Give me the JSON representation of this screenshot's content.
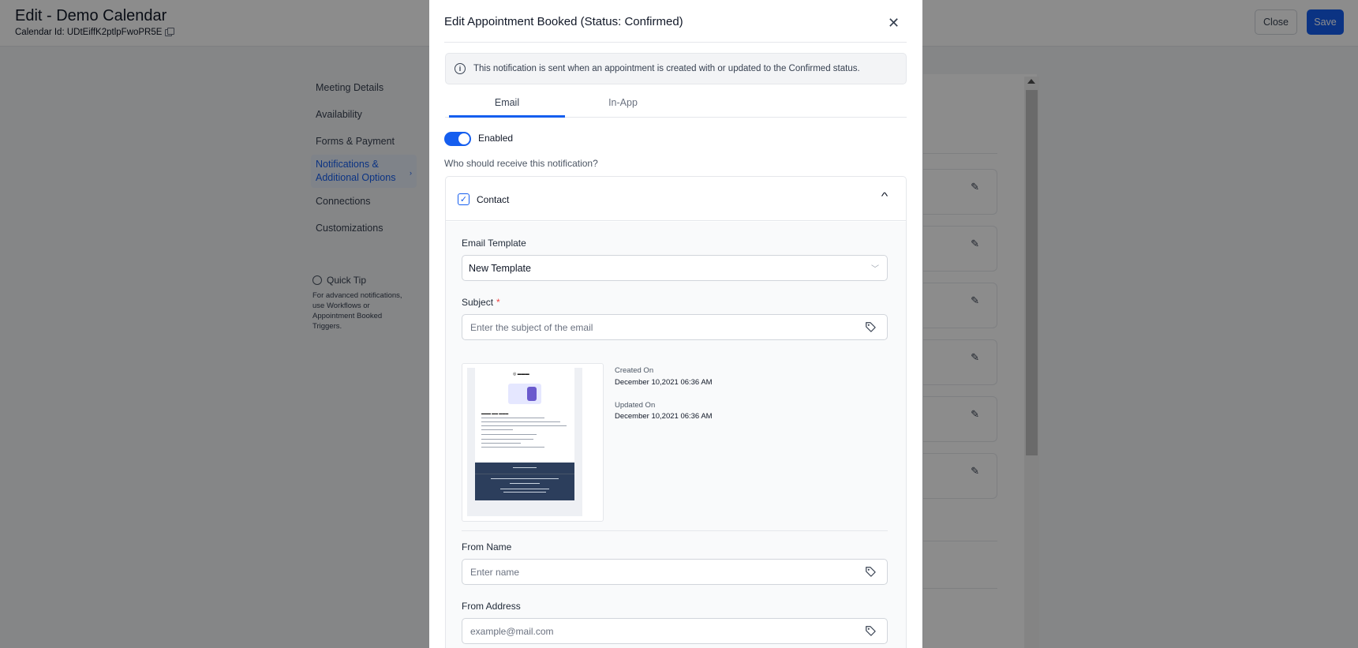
{
  "page": {
    "title": "Edit - Demo Calendar",
    "calendar_id": "Calendar Id: UDtEiffK2ptlpFwoPR5E",
    "close_label": "Close",
    "save_label": "Save"
  },
  "sidebar": {
    "items": [
      {
        "label": "Meeting Details"
      },
      {
        "label": "Availability"
      },
      {
        "label": "Forms & Payment"
      },
      {
        "label": "Notifications & Additional Options",
        "active": true
      },
      {
        "label": "Connections"
      },
      {
        "label": "Customizations"
      }
    ],
    "quick_tip": {
      "title": "Quick Tip",
      "text": "For advanced notifications, use Workflows or Appointment Booked Triggers."
    }
  },
  "modal": {
    "title": "Edit Appointment Booked (Status: Confirmed)",
    "info": "This notification is sent when an appointment is created with or updated to the Confirmed status.",
    "tabs": [
      {
        "label": "Email",
        "active": true
      },
      {
        "label": "In-App",
        "active": false
      }
    ],
    "toggle": {
      "label": "Enabled",
      "on": true
    },
    "who_label": "Who should receive this notification?",
    "contact": {
      "label": "Contact",
      "checked": true,
      "email_template_label": "Email Template",
      "email_template_value": "New Template",
      "subject_label": "Subject",
      "subject_required": "*",
      "subject_placeholder": "Enter the subject of the email",
      "created_on_label": "Created On",
      "created_on_value": "December 10,2021 06:36 AM",
      "updated_on_label": "Updated On",
      "updated_on_value": "December 10,2021 06:36 AM",
      "from_name_label": "From Name",
      "from_name_placeholder": "Enter name",
      "from_address_label": "From Address",
      "from_address_placeholder": "example@mail.com"
    }
  },
  "colors": {
    "accent": "#155eef",
    "overlay": "rgba(0,0,0,0.45)",
    "required": "#ef4444"
  }
}
